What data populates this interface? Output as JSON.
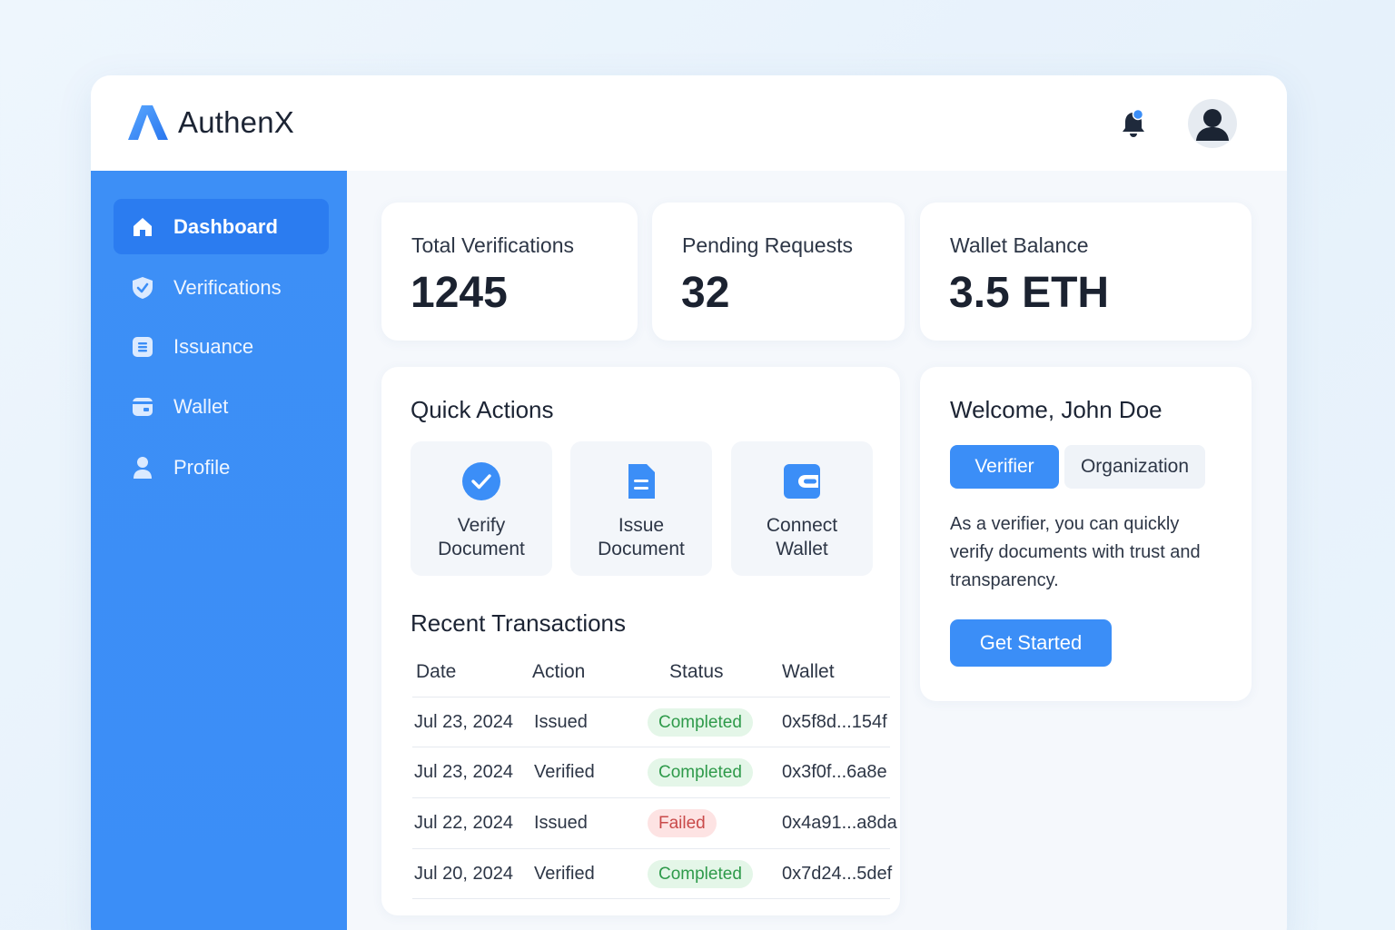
{
  "app": {
    "name": "AuthenX"
  },
  "colors": {
    "primary": "#3b8ef7",
    "sidebar": "#3d8ff6",
    "success": "#2e9a4a",
    "danger": "#c94a4a"
  },
  "header": {
    "notification_icon": "bell-icon",
    "avatar_icon": "user-avatar-icon"
  },
  "sidebar": {
    "items": [
      {
        "label": "Dashboard",
        "icon": "home-icon",
        "active": true
      },
      {
        "label": "Verifications",
        "icon": "shield-check-icon",
        "active": false
      },
      {
        "label": "Issuance",
        "icon": "document-list-icon",
        "active": false
      },
      {
        "label": "Wallet",
        "icon": "wallet-icon",
        "active": false
      },
      {
        "label": "Profile",
        "icon": "user-icon",
        "active": false
      }
    ]
  },
  "stats": [
    {
      "label": "Total Verifications",
      "value": "1245"
    },
    {
      "label": "Pending Requests",
      "value": "32"
    },
    {
      "label": "Wallet Balance",
      "value": "3.5 ETH"
    }
  ],
  "quick_actions": {
    "title": "Quick Actions",
    "items": [
      {
        "label": "Verify\nDocument",
        "icon": "check-circle-icon"
      },
      {
        "label": "Issue\nDocument",
        "icon": "document-icon"
      },
      {
        "label": "Connect\nWallet",
        "icon": "wallet-icon"
      }
    ]
  },
  "transactions": {
    "title": "Recent Transactions",
    "columns": [
      "Date",
      "Action",
      "Status",
      "Wallet"
    ],
    "rows": [
      {
        "date": "Jul 23, 2024",
        "action": "Issued",
        "status": "Completed",
        "wallet": "0x5f8d...154f"
      },
      {
        "date": "Jul 23, 2024",
        "action": "Verified",
        "status": "Completed",
        "wallet": "0x3f0f...6a8e"
      },
      {
        "date": "Jul 22, 2024",
        "action": "Issued",
        "status": "Failed",
        "wallet": "0x4a91...a8da"
      },
      {
        "date": "Jul 20, 2024",
        "action": "Verified",
        "status": "Completed",
        "wallet": "0x7d24...5def"
      }
    ]
  },
  "welcome": {
    "title": "Welcome, John Doe",
    "roles": [
      "Verifier",
      "Organization"
    ],
    "selected_role": "Verifier",
    "description": "As a verifier, you can quickly verify documents with trust and transparency.",
    "cta": "Get Started"
  }
}
